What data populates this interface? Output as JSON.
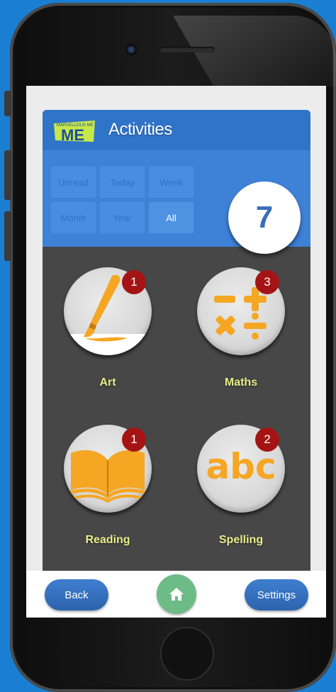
{
  "app": {
    "logo_text": "MARVELLOUS ME",
    "title": "Activities"
  },
  "filters": {
    "items": [
      {
        "label": "Unread",
        "active": false
      },
      {
        "label": "Today",
        "active": false
      },
      {
        "label": "Week",
        "active": false
      },
      {
        "label": "Month",
        "active": false
      },
      {
        "label": "Year",
        "active": false
      },
      {
        "label": "All",
        "active": true
      }
    ],
    "total_count": "7"
  },
  "activities": [
    {
      "label": "Art",
      "badge": "1",
      "icon": "paintbrush-icon"
    },
    {
      "label": "Maths",
      "badge": "3",
      "icon": "math-symbols-icon"
    },
    {
      "label": "Reading",
      "badge": "1",
      "icon": "open-book-icon"
    },
    {
      "label": "Spelling",
      "badge": "2",
      "icon": "abc-icon"
    }
  ],
  "bottom": {
    "back_label": "Back",
    "home_icon": "home-icon",
    "settings_label": "Settings"
  },
  "colors": {
    "header": "#2f74c9",
    "panel": "#474747",
    "label": "#e8ef8a",
    "badge": "#a51414",
    "icon_orange": "#f5a623",
    "home": "#6dbb86"
  }
}
